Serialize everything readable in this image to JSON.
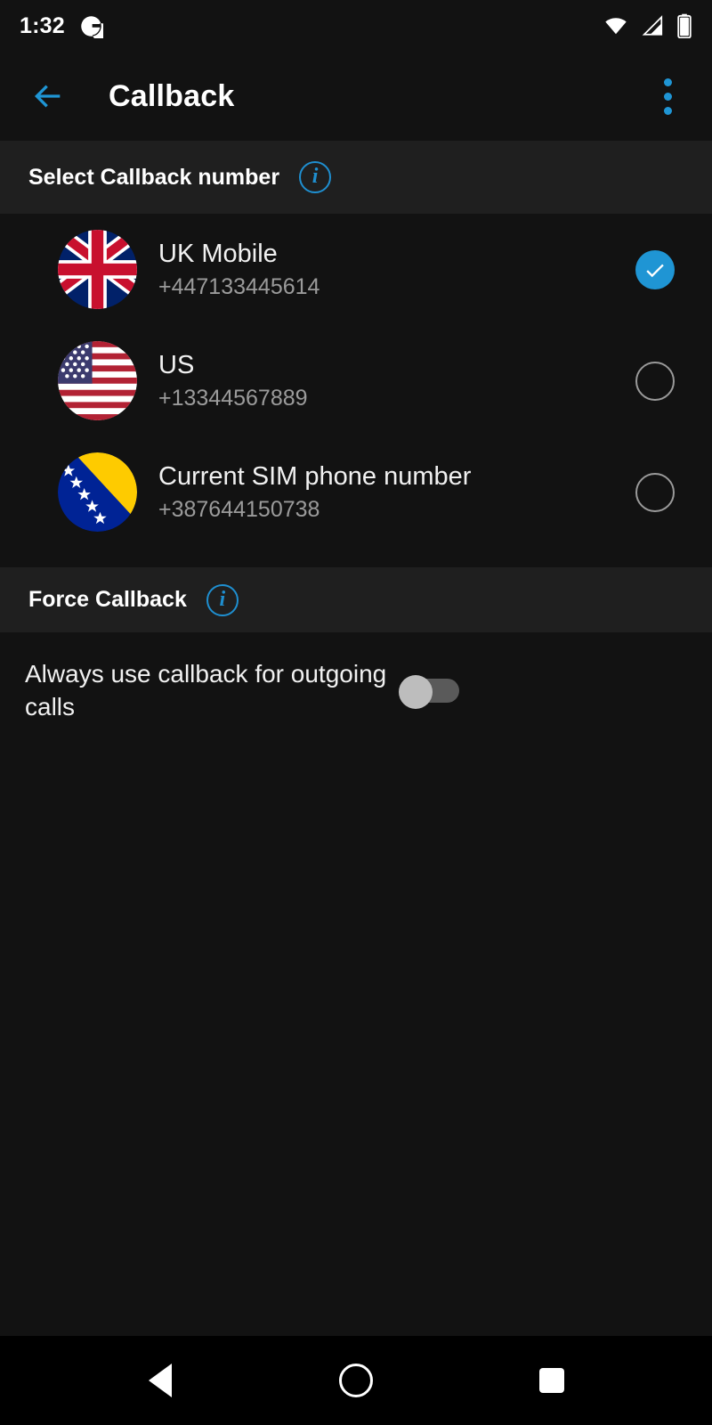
{
  "status_bar": {
    "time": "1:32",
    "notification_icon": "g-circle-icon",
    "wifi_icon": "wifi-icon",
    "signal_icon": "cell-signal-icon",
    "battery_icon": "battery-icon"
  },
  "app_bar": {
    "back_icon": "arrow-back-icon",
    "title": "Callback",
    "overflow_icon": "more-vertical-icon"
  },
  "sections": {
    "callback_number": {
      "title": "Select Callback number",
      "info_icon": "info-icon",
      "info_glyph": "i"
    },
    "force_callback": {
      "title": "Force Callback",
      "info_icon": "info-icon",
      "info_glyph": "i"
    }
  },
  "callback_numbers": [
    {
      "flag": "uk-flag-icon",
      "label": "UK Mobile",
      "number": "+447133445614",
      "selected": true
    },
    {
      "flag": "us-flag-icon",
      "label": "US",
      "number": "+13344567889",
      "selected": false
    },
    {
      "flag": "bosnia-flag-icon",
      "label": "Current SIM phone number",
      "number": "+387644150738",
      "selected": false
    }
  ],
  "force_callback_setting": {
    "label": "Always use callback for outgoing calls",
    "enabled": false
  },
  "nav_bar": {
    "back": "nav-back-icon",
    "home": "nav-home-icon",
    "recents": "nav-recents-icon"
  },
  "colors": {
    "accent": "#1f95d4",
    "background": "#121212",
    "section_background": "#1f1f1f",
    "text_primary": "#f1f1f1",
    "text_secondary": "#9b9b9b"
  }
}
